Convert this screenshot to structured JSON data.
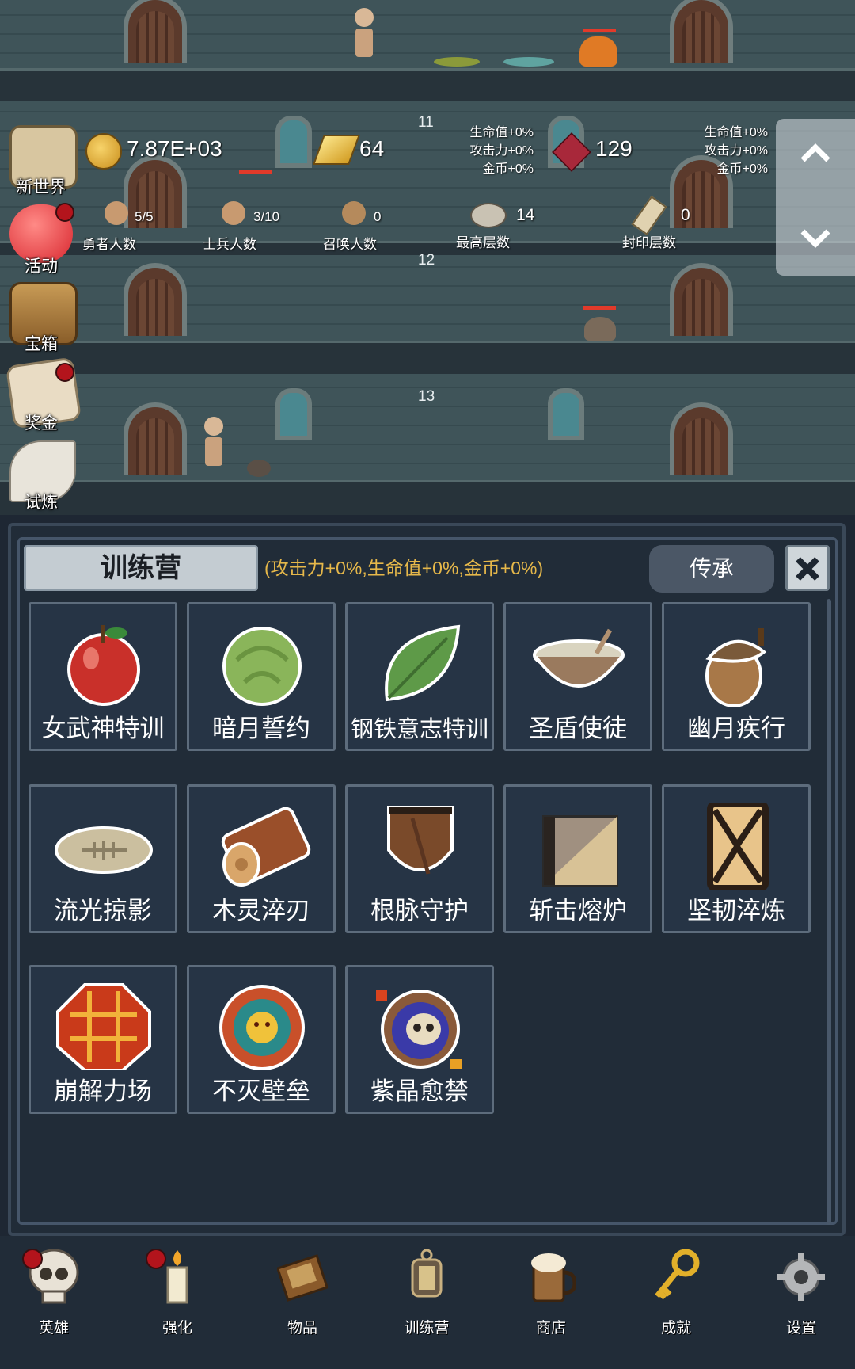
{
  "floors": {
    "top_floor": "11",
    "middle_floor": "12",
    "bottom_floor": "13"
  },
  "resources": {
    "gold": "7.87E+03",
    "gold_bars": "64",
    "gems": "129"
  },
  "bonuses": {
    "gold_bar_bonus": [
      "生命值+0%",
      "攻击力+0%",
      "金币+0%"
    ],
    "gem_bonus": [
      "生命值+0%",
      "攻击力+0%",
      "金币+0%"
    ]
  },
  "stats": {
    "heroes": {
      "value": "5/5",
      "label": "勇者人数"
    },
    "soldiers": {
      "value": "3/10",
      "label": "士兵人数"
    },
    "summons": {
      "value": "0",
      "label": "召唤人数"
    },
    "max_floor": {
      "value": "14",
      "label": "最高层数"
    },
    "sealed_floor": {
      "value": "0",
      "label": "封印层数"
    }
  },
  "side_menu": [
    {
      "label": "新世界",
      "badge": false
    },
    {
      "label": "活动",
      "badge": true
    },
    {
      "label": "宝箱",
      "badge": false
    },
    {
      "label": "奖金",
      "badge": true
    },
    {
      "label": "试炼",
      "badge": false
    }
  ],
  "panel": {
    "title": "训练营",
    "bonus_text": "(攻击力+0%,生命值+0%,金币+0%)",
    "inherit_label": "传承"
  },
  "skills": [
    {
      "name": "女武神特训",
      "icon": "apple-icon"
    },
    {
      "name": "暗月誓约",
      "icon": "cabbage-icon"
    },
    {
      "name": "钢铁意志特训",
      "icon": "leaf-icon"
    },
    {
      "name": "圣盾使徒",
      "icon": "porridge-bowl-icon"
    },
    {
      "name": "幽月疾行",
      "icon": "acorn-icon"
    },
    {
      "name": "流光掠影",
      "icon": "bone-stone-icon"
    },
    {
      "name": "木灵淬刃",
      "icon": "log-icon"
    },
    {
      "name": "根脉守护",
      "icon": "wooden-shield-icon"
    },
    {
      "name": "斩击熔炉",
      "icon": "block-icon"
    },
    {
      "name": "坚韧淬炼",
      "icon": "tower-shield-icon"
    },
    {
      "name": "崩解力场",
      "icon": "lava-orb-icon"
    },
    {
      "name": "不灭壁垒",
      "icon": "sun-orb-icon"
    },
    {
      "name": "紫晶愈禁",
      "icon": "skull-ring-icon"
    }
  ],
  "nav": [
    {
      "label": "英雄",
      "icon": "skull-icon",
      "badge": true
    },
    {
      "label": "强化",
      "icon": "candle-icon",
      "badge": true
    },
    {
      "label": "物品",
      "icon": "book-icon",
      "badge": false
    },
    {
      "label": "训练营",
      "icon": "lantern-icon",
      "badge": false
    },
    {
      "label": "商店",
      "icon": "beer-mug-icon",
      "badge": false
    },
    {
      "label": "成就",
      "icon": "key-icon",
      "badge": false
    },
    {
      "label": "设置",
      "icon": "gear-icon",
      "badge": false
    }
  ],
  "colors": {
    "accent": "#e6b84a",
    "badge": "#b3141c",
    "panel_bg": "#212c38"
  }
}
